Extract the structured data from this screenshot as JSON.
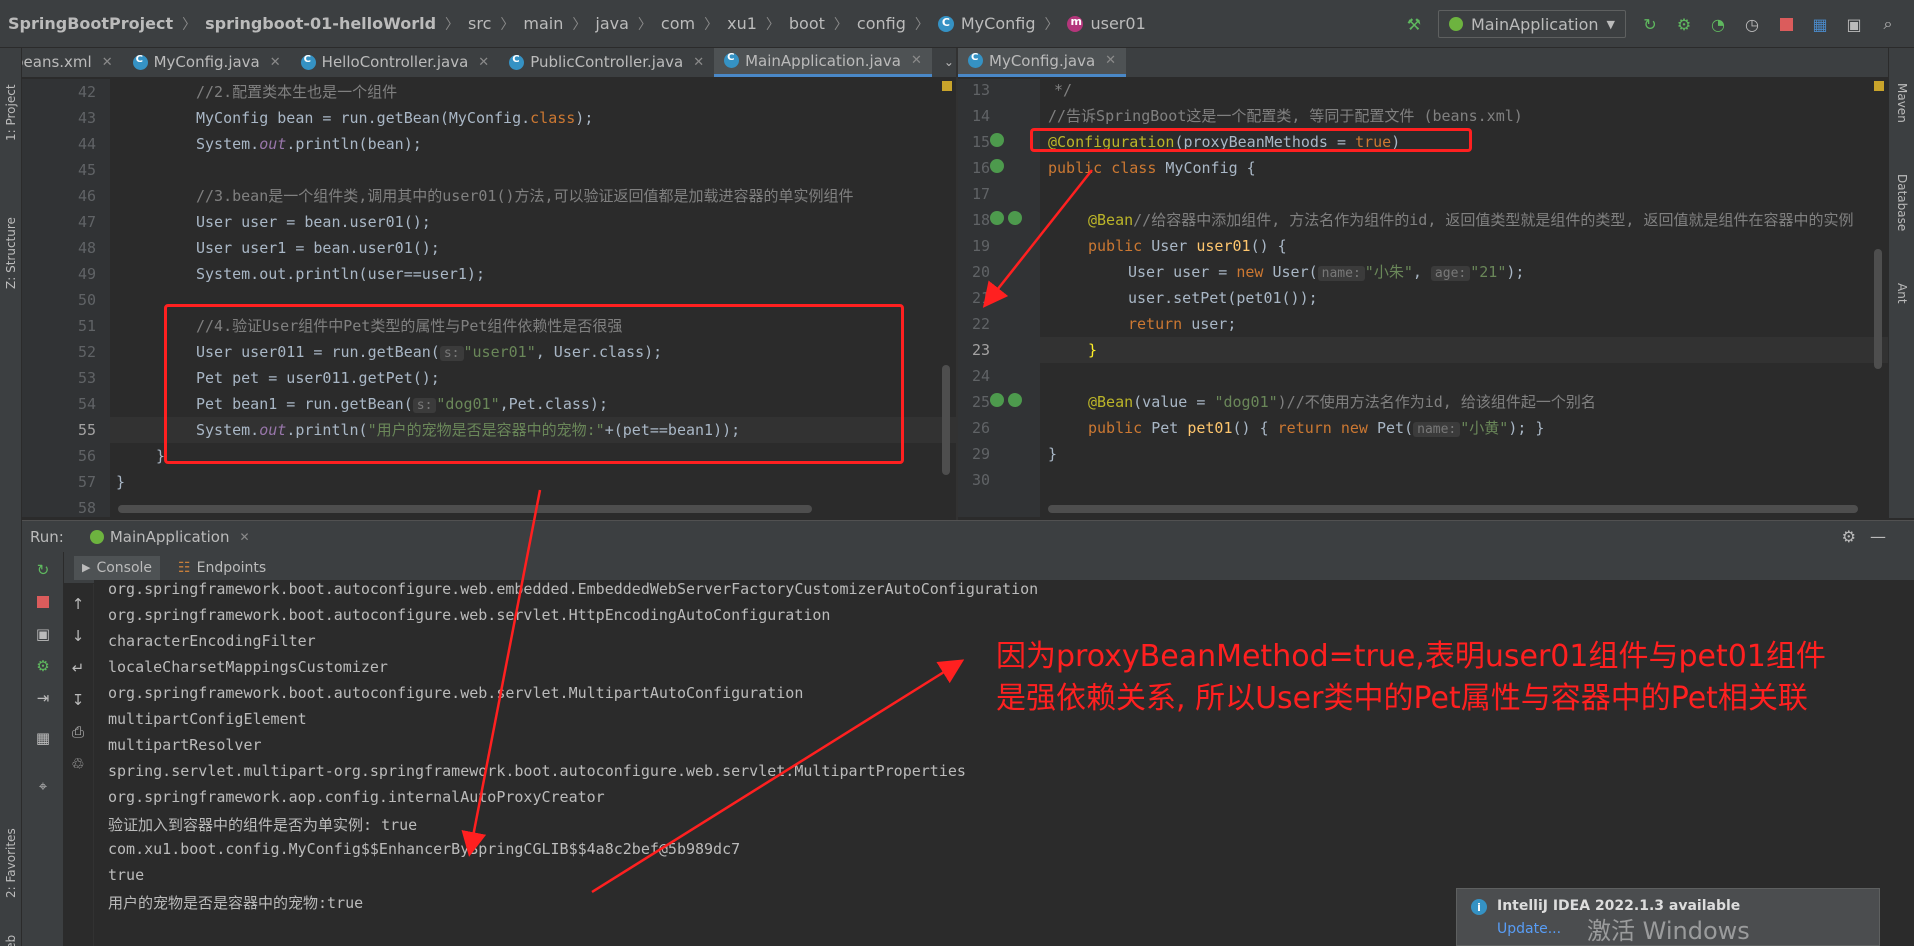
{
  "breadcrumb": {
    "project": "SpringBootProject",
    "module": "springboot-01-helloWorld",
    "path": [
      "src",
      "main",
      "java",
      "com",
      "xu1",
      "boot",
      "config"
    ],
    "class": "MyConfig",
    "method": "user01"
  },
  "toolbar": {
    "run_config": "MainApplication",
    "icons": [
      "hammer-icon",
      "rerun-icon",
      "debug-icon",
      "coverage-icon",
      "profile-icon",
      "stop-icon",
      "project-structure-icon",
      "layout-icon",
      "search-icon"
    ]
  },
  "left_editor": {
    "tabs": [
      {
        "label": "beans.xml",
        "icon": "xml-icon",
        "active": false
      },
      {
        "label": "MyConfig.java",
        "icon": "class-icon",
        "active": false
      },
      {
        "label": "HelloController.java",
        "icon": "class-icon",
        "active": false
      },
      {
        "label": "PublicController.java",
        "icon": "class-icon",
        "active": false
      },
      {
        "label": "MainApplication.java",
        "icon": "class-icon",
        "active": true
      }
    ],
    "line_numbers": [
      "42",
      "43",
      "44",
      "45",
      "46",
      "47",
      "48",
      "49",
      "50",
      "51",
      "52",
      "53",
      "54",
      "55",
      "56",
      "57",
      "58"
    ],
    "lines": [
      "//2.配置类本生也是一个组件",
      "MyConfig bean = run.getBean(MyConfig.class);",
      "System.out.println(bean);",
      "",
      "//3.bean是一个组件类,调用其中的user01()方法,可以验证返回值都是加载进容器的单实例组件",
      "User user = bean.user01();",
      "User user1 = bean.user01();",
      "System.out.println(user==user1);",
      "",
      "//4.验证User组件中Pet类型的属性与Pet组件依赖性是否很强",
      "User user011 = run.getBean(",
      "s:",
      "\"user01\"",
      ", User.class);",
      "Pet pet = user011.getPet();",
      "Pet bean1 = run.getBean(",
      "\"dog01\"",
      ",Pet.class);",
      "System.out.println(",
      "\"用户的宠物是否是容器中的宠物:\"",
      "+(pet==bean1));",
      "}",
      "}"
    ]
  },
  "right_editor": {
    "tabs": [
      {
        "label": "MyConfig.java",
        "icon": "class-icon",
        "active": true
      }
    ],
    "line_numbers": [
      "13",
      "14",
      "15",
      "16",
      "17",
      "18",
      "19",
      "20",
      "21",
      "22",
      "23",
      "24",
      "25",
      "26",
      "29",
      "30"
    ],
    "lines": [
      "*/",
      "//告诉SpringBoot这是一个配置类, 等同于配置文件 (beans.xml)",
      "@Configuration",
      "(proxyBeanMethods = ",
      "true",
      ")",
      "public class",
      " MyConfig {",
      "@Bean",
      "//给容器中添加组件, 方法名作为组件的id, 返回值类型就是组件的类型, 返回值就是组件在容器中的实例",
      "public",
      " User ",
      "user01",
      "() {",
      "User user = ",
      "new",
      " User(",
      "name:",
      "\"小朱\"",
      ", ",
      "age:",
      "\"21\"",
      ");",
      "user.setPet(pet01());",
      "return",
      " user;",
      "}",
      "@Bean",
      "(value = ",
      "\"dog01\"",
      ")//不使用方法名作为id, 给该组件起一个别名",
      "public",
      " Pet ",
      "pet01",
      "() { ",
      "return new",
      " Pet(",
      "name:",
      "\"小黄\"",
      "); }",
      "}"
    ]
  },
  "run_panel": {
    "label": "Run:",
    "tab": "MainApplication",
    "subtabs": [
      "Console",
      "Endpoints"
    ],
    "console_lines": [
      "org.springframework.boot.autoconfigure.web.embedded.EmbeddedWebServerFactoryCustomizerAutoConfiguration",
      "org.springframework.boot.autoconfigure.web.servlet.HttpEncodingAutoConfiguration",
      "characterEncodingFilter",
      "localeCharsetMappingsCustomizer",
      "org.springframework.boot.autoconfigure.web.servlet.MultipartAutoConfiguration",
      "multipartConfigElement",
      "multipartResolver",
      "spring.servlet.multipart-org.springframework.boot.autoconfigure.web.servlet.MultipartProperties",
      "org.springframework.aop.config.internalAutoProxyCreator",
      "验证加入到容器中的组件是否为单实例: true",
      "com.xu1.boot.config.MyConfig$$EnhancerBySpringCGLIB$$4a8c2bef@5b989dc7",
      "true",
      "用户的宠物是否是容器中的宠物:true"
    ]
  },
  "side_tabs": {
    "left": [
      "1: Project",
      "Z: Structure",
      "2: Favorites",
      "Web"
    ],
    "right": [
      "Maven",
      "Database",
      "Ant"
    ]
  },
  "annotation": {
    "line1": "因为proxyBeanMethod=true,表明user01组件与pet01组件",
    "line2": "是强依赖关系, 所以User类中的Pet属性与容器中的Pet相关联"
  },
  "notification": {
    "title": "IntelliJ IDEA 2022.1.3 available",
    "link": "Update...",
    "watermark": "激活 Windows"
  },
  "colors": {
    "accent": "#4a88c7",
    "annotation_red": "#ff2020",
    "background": "#2b2b2b",
    "panel": "#3c3f41"
  }
}
